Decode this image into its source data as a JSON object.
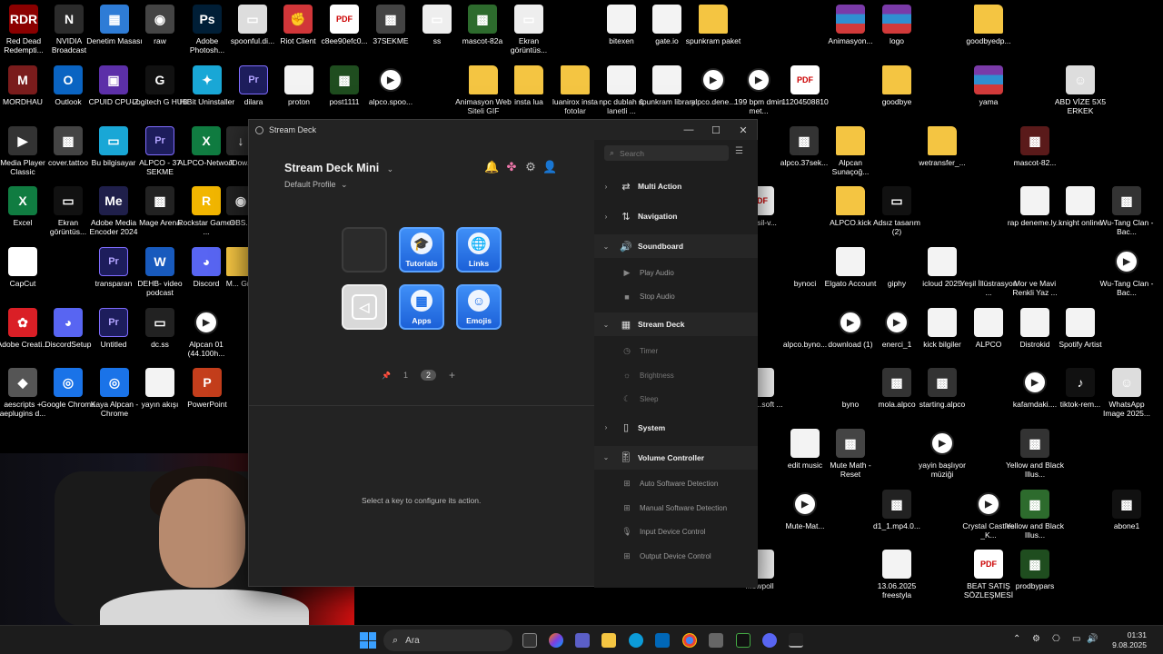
{
  "desktop": {
    "icons": [
      {
        "id": "d1",
        "label": "Red Dead Redempti...",
        "glyph": "RDR",
        "color": "#8b0000"
      },
      {
        "id": "d2",
        "label": "NVIDIA Broadcast",
        "glyph": "N",
        "color": "#2b2b2b"
      },
      {
        "id": "d3",
        "label": "Denetim Masası",
        "glyph": "▦",
        "color": "#2e7cd6"
      },
      {
        "id": "d4",
        "label": "raw",
        "glyph": "◉",
        "color": "#444"
      },
      {
        "id": "d5",
        "label": "Adobe Photosh...",
        "glyph": "Ps",
        "color": "#001e36"
      },
      {
        "id": "d6",
        "label": "spoonful.di...",
        "glyph": "▭",
        "color": "#ddd"
      },
      {
        "id": "d7",
        "label": "Riot Client",
        "glyph": "✊",
        "color": "#d13639"
      },
      {
        "id": "d8",
        "label": "c8ee90efc0...",
        "glyph": "PDF",
        "kind": "pdf"
      },
      {
        "id": "d9",
        "label": "37SEKME",
        "glyph": "▩",
        "color": "#444"
      },
      {
        "id": "d10",
        "label": "ss",
        "glyph": "▭",
        "color": "#eee"
      },
      {
        "id": "d11",
        "label": "mascot-82a",
        "glyph": "▩",
        "color": "#2d6b2d"
      },
      {
        "id": "d12",
        "label": "Ekran görüntüs...",
        "glyph": "▭",
        "color": "#eee"
      },
      {
        "id": "d13",
        "label": "bitexen",
        "glyph": "",
        "kind": "file"
      },
      {
        "id": "d14",
        "label": "gate.io",
        "glyph": "",
        "kind": "file"
      },
      {
        "id": "d15",
        "label": "spunkram paket",
        "glyph": "",
        "kind": "folder"
      },
      {
        "id": "d16",
        "label": "Animasyon...",
        "glyph": "",
        "kind": "rar"
      },
      {
        "id": "d17",
        "label": "logo",
        "glyph": "",
        "kind": "rar"
      },
      {
        "id": "d18",
        "label": "goodbyedp...",
        "glyph": "",
        "kind": "folder"
      },
      {
        "id": "d19",
        "label": "MORDHAU",
        "glyph": "M",
        "color": "#7a1c1c"
      },
      {
        "id": "d20",
        "label": "Outlook",
        "glyph": "O",
        "color": "#0a64c2"
      },
      {
        "id": "d21",
        "label": "CPUID CPU-Z",
        "glyph": "▣",
        "color": "#5c2fa8"
      },
      {
        "id": "d22",
        "label": "Logitech G HUB",
        "glyph": "G",
        "color": "#111"
      },
      {
        "id": "d23",
        "label": "HiBit Uninstaller",
        "glyph": "✦",
        "color": "#19a7d6"
      },
      {
        "id": "d24",
        "label": "dilara",
        "glyph": "Pr",
        "kind": "pr"
      },
      {
        "id": "d25",
        "label": "proton",
        "glyph": "",
        "kind": "file"
      },
      {
        "id": "d26",
        "label": "post1111",
        "glyph": "▩",
        "color": "#1f4d1f"
      },
      {
        "id": "d27",
        "label": "alpco.spoo...",
        "glyph": "▶",
        "kind": "video"
      },
      {
        "id": "d28",
        "label": "Animasyon Web Siteli GIF",
        "glyph": "",
        "kind": "folder"
      },
      {
        "id": "d29",
        "label": "insta lua",
        "glyph": "",
        "kind": "folder"
      },
      {
        "id": "d30",
        "label": "luanirox insta fotolar",
        "glyph": "",
        "kind": "folder"
      },
      {
        "id": "d31",
        "label": "npc dublah & lanetli ...",
        "glyph": "",
        "kind": "file"
      },
      {
        "id": "d32",
        "label": "spunkram library",
        "glyph": "",
        "kind": "file"
      },
      {
        "id": "d33",
        "label": "alpco.dene...",
        "glyph": "▶",
        "kind": "video"
      },
      {
        "id": "d34",
        "label": "199 bpm dmin met...",
        "glyph": "▶",
        "kind": "video"
      },
      {
        "id": "d35",
        "label": "11204508810",
        "glyph": "PDF",
        "kind": "pdf"
      },
      {
        "id": "d36",
        "label": "goodbye",
        "glyph": "",
        "kind": "folder"
      },
      {
        "id": "d37",
        "label": "yama",
        "glyph": "",
        "kind": "rar"
      },
      {
        "id": "d38",
        "label": "ABD VİZE 5X5 ERKEK",
        "glyph": "☺",
        "color": "#ddd"
      },
      {
        "id": "d39",
        "label": "Media Player Classic",
        "glyph": "▶",
        "color": "#333"
      },
      {
        "id": "d40",
        "label": "cover.tattoo",
        "glyph": "▩",
        "color": "#444"
      },
      {
        "id": "d41",
        "label": "Bu bilgisayar",
        "glyph": "▭",
        "color": "#19a7d6"
      },
      {
        "id": "d42",
        "label": "ALPCO - 37 SEKME",
        "glyph": "Pr",
        "kind": "pr"
      },
      {
        "id": "d43",
        "label": "ALPCO-Network",
        "glyph": "X",
        "color": "#107c41"
      },
      {
        "id": "d44",
        "label": "JDow...",
        "glyph": "↓",
        "color": "#2b2b2b"
      },
      {
        "id": "d45",
        "label": "alpco.37sek...",
        "glyph": "▩",
        "color": "#333"
      },
      {
        "id": "d46",
        "label": "Alpcan Sunaçoğ...",
        "glyph": "",
        "kind": "folder"
      },
      {
        "id": "d47",
        "label": "wetransfer_...",
        "glyph": "",
        "kind": "folder"
      },
      {
        "id": "d48",
        "label": "mascot-82...",
        "glyph": "▩",
        "color": "#5a1a1a"
      },
      {
        "id": "d49",
        "label": "Excel",
        "glyph": "X",
        "color": "#107c41"
      },
      {
        "id": "d50",
        "label": "Ekran görüntüs...",
        "glyph": "▭",
        "color": "#111"
      },
      {
        "id": "d51",
        "label": "Adobe Media Encoder 2024",
        "glyph": "Me",
        "color": "#1f1f4a"
      },
      {
        "id": "d52",
        "label": "Mage Arena",
        "glyph": "▩",
        "color": "#222"
      },
      {
        "id": "d53",
        "label": "Rockstar Games ...",
        "glyph": "R",
        "color": "#f2b600"
      },
      {
        "id": "d54",
        "label": "OBS...",
        "glyph": "◉",
        "color": "#222"
      },
      {
        "id": "d55",
        "label": "...ecsil-v...",
        "glyph": "PDF",
        "kind": "pdf"
      },
      {
        "id": "d56",
        "label": "ALPCO.kick",
        "glyph": "",
        "kind": "folder"
      },
      {
        "id": "d57",
        "label": "Adsız tasarım (2)",
        "glyph": "▭",
        "color": "#111"
      },
      {
        "id": "d58",
        "label": "rap deneme.ly...",
        "glyph": "",
        "kind": "file"
      },
      {
        "id": "d59",
        "label": "knight online",
        "glyph": "",
        "kind": "file"
      },
      {
        "id": "d60",
        "label": "Wu-Tang Clan - Bac...",
        "glyph": "▩",
        "color": "#333"
      },
      {
        "id": "d61",
        "label": "CapCut",
        "glyph": "✂",
        "color": "#fff"
      },
      {
        "id": "d62",
        "label": "transparan",
        "glyph": "Pr",
        "kind": "pr"
      },
      {
        "id": "d63",
        "label": "DEHB- video podcast",
        "glyph": "W",
        "color": "#185abd"
      },
      {
        "id": "d64",
        "label": "Discord",
        "glyph": "◕",
        "color": "#5865f2"
      },
      {
        "id": "d65",
        "label": "M... Gr...",
        "glyph": "",
        "kind": "folder"
      },
      {
        "id": "d66",
        "label": "bynoci",
        "glyph": "",
        "color": "#000"
      },
      {
        "id": "d67",
        "label": "Elgato Account",
        "glyph": "",
        "kind": "file"
      },
      {
        "id": "d68",
        "label": "giphy",
        "glyph": "",
        "color": "#000"
      },
      {
        "id": "d69",
        "label": "icloud 2025",
        "glyph": "",
        "kind": "file"
      },
      {
        "id": "d70",
        "label": "Yeşil İllüstrasyon ...",
        "glyph": "",
        "color": "#000"
      },
      {
        "id": "d71",
        "label": "Mor ve Mavi Renkli Yaz ...",
        "glyph": "",
        "color": "#000"
      },
      {
        "id": "d72",
        "label": "Wu-Tang Clan - Bac...",
        "glyph": "▶",
        "kind": "video"
      },
      {
        "id": "d73",
        "label": "Adobe Creati...",
        "glyph": "✿",
        "color": "#da1f26"
      },
      {
        "id": "d74",
        "label": "DiscordSetup",
        "glyph": "◕",
        "color": "#5865f2"
      },
      {
        "id": "d75",
        "label": "Untitled",
        "glyph": "Pr",
        "kind": "pr"
      },
      {
        "id": "d76",
        "label": "dc.ss",
        "glyph": "▭",
        "color": "#222"
      },
      {
        "id": "d77",
        "label": "Alpcan 01 (44.100h...",
        "glyph": "▶",
        "kind": "video"
      },
      {
        "id": "d78",
        "label": "alpco.byno...",
        "glyph": "",
        "color": "#000"
      },
      {
        "id": "d79",
        "label": "download (1)",
        "glyph": "▶",
        "kind": "video"
      },
      {
        "id": "d80",
        "label": "enerci_1",
        "glyph": "▶",
        "kind": "video"
      },
      {
        "id": "d81",
        "label": "kick bilgiler",
        "glyph": "",
        "kind": "file"
      },
      {
        "id": "d82",
        "label": "ALPCO",
        "glyph": "",
        "kind": "file"
      },
      {
        "id": "d83",
        "label": "Distrokid",
        "glyph": "",
        "kind": "file"
      },
      {
        "id": "d84",
        "label": "Spotify Artist",
        "glyph": "",
        "kind": "file"
      },
      {
        "id": "d85",
        "label": "aescripts + aeplugins d...",
        "glyph": "◆",
        "color": "#555"
      },
      {
        "id": "d86",
        "label": "Google Chrome",
        "glyph": "◎",
        "color": "#1a73e8"
      },
      {
        "id": "d87",
        "label": "Kaya Alpcan - Chrome",
        "glyph": "◎",
        "color": "#1a73e8"
      },
      {
        "id": "d88",
        "label": "yayın akışı",
        "glyph": "",
        "kind": "file"
      },
      {
        "id": "d89",
        "label": "PowerPoint",
        "glyph": "P",
        "color": "#c43e1c"
      },
      {
        "id": "d90",
        "label": "...eni ...soft ...",
        "glyph": "",
        "kind": "file"
      },
      {
        "id": "d91",
        "label": "byno",
        "glyph": "",
        "color": "#000"
      },
      {
        "id": "d92",
        "label": "mola.alpco",
        "glyph": "▩",
        "color": "#333"
      },
      {
        "id": "d93",
        "label": "starting.alpco",
        "glyph": "▩",
        "color": "#333"
      },
      {
        "id": "d94",
        "label": "kafamdaki....",
        "glyph": "▶",
        "kind": "video"
      },
      {
        "id": "d95",
        "label": "tiktok-rem...",
        "glyph": "♪",
        "color": "#111"
      },
      {
        "id": "d96",
        "label": "WhatsApp Image 2025...",
        "glyph": "☺",
        "color": "#ddd"
      },
      {
        "id": "d97",
        "label": "edit music",
        "glyph": "",
        "kind": "file"
      },
      {
        "id": "d98",
        "label": "Mute Math - Reset",
        "glyph": "▩",
        "color": "#444"
      },
      {
        "id": "d99",
        "label": "yayin başlıyor müziği",
        "glyph": "▶",
        "kind": "video"
      },
      {
        "id": "d100",
        "label": "Yellow and Black Illus...",
        "glyph": "▩",
        "color": "#333"
      },
      {
        "id": "d101",
        "label": "Mute-Mat...",
        "glyph": "▶",
        "kind": "video"
      },
      {
        "id": "d102",
        "label": "d1_1.mp4.0...",
        "glyph": "▩",
        "color": "#222"
      },
      {
        "id": "d103",
        "label": "Crystal Castles _K...",
        "glyph": "▶",
        "kind": "video"
      },
      {
        "id": "d104",
        "label": "Yellow and Black Illus...",
        "glyph": "▩",
        "color": "#2d6b2d"
      },
      {
        "id": "d105",
        "label": "abone1",
        "glyph": "▩",
        "color": "#111"
      },
      {
        "id": "d106",
        "label": "...ewpoll",
        "glyph": "",
        "kind": "file"
      },
      {
        "id": "d107",
        "label": "13.06.2025 freestyla",
        "glyph": "",
        "kind": "file"
      },
      {
        "id": "d108",
        "label": "BEAT SATIŞ SÖZLEŞMESİ",
        "glyph": "PDF",
        "kind": "pdf"
      },
      {
        "id": "d109",
        "label": "prodbypars",
        "glyph": "▩",
        "color": "#1f4d1f"
      }
    ]
  },
  "window": {
    "title": "Stream Deck",
    "minimize_icon": "—",
    "maximize_icon": "☐",
    "close_icon": "✕"
  },
  "device": {
    "name": "Stream Deck Mini",
    "profile": "Default Profile",
    "header_icons": {
      "bell": "🔔",
      "marketplace": "✤",
      "settings": "⚙",
      "account": "👤"
    }
  },
  "keys": [
    {
      "label": "",
      "icon": "",
      "style": "empty"
    },
    {
      "label": "Tutorials",
      "icon": "🎓",
      "style": "blue"
    },
    {
      "label": "Links",
      "icon": "🌐",
      "style": "blue"
    },
    {
      "label": "",
      "icon": "◁",
      "style": "back"
    },
    {
      "label": "Apps",
      "icon": "▦",
      "style": "blue"
    },
    {
      "label": "Emojis",
      "icon": "☺",
      "style": "blue"
    }
  ],
  "pager": {
    "pin_icon": "📌",
    "pages": [
      "1",
      "2"
    ],
    "current": "2",
    "add": "+"
  },
  "hint": "Select a key to configure its action.",
  "actions_panel": {
    "search_placeholder": "Search",
    "list_icon": "☰",
    "categories": [
      {
        "label": "Multi Action",
        "icon": "⇄",
        "chevron": "›",
        "open": false
      },
      {
        "label": "Navigation",
        "icon": "⇅",
        "chevron": "›",
        "open": false
      },
      {
        "label": "Soundboard",
        "icon": "🔊",
        "chevron": "⌄",
        "open": true,
        "items": [
          {
            "label": "Play Audio",
            "icon": "▶"
          },
          {
            "label": "Stop Audio",
            "icon": "■"
          }
        ]
      },
      {
        "label": "Stream Deck",
        "icon": "▦",
        "chevron": "⌄",
        "open": true,
        "items": [
          {
            "label": "Timer",
            "icon": "◷"
          },
          {
            "label": "Brightness",
            "icon": "☼"
          },
          {
            "label": "Sleep",
            "icon": "☾"
          }
        ]
      },
      {
        "label": "System",
        "icon": "▯",
        "chevron": "›",
        "open": false
      },
      {
        "label": "Volume Controller",
        "icon": "🎚",
        "chevron": "⌄",
        "open": true,
        "items": [
          {
            "label": "Auto Software Detection",
            "icon": "⊞"
          },
          {
            "label": "Manual Software Detection",
            "icon": "⊞"
          },
          {
            "label": "Input Device Control",
            "icon": "🎙"
          },
          {
            "label": "Output Device Control",
            "icon": "⊞"
          }
        ]
      }
    ]
  },
  "taskbar": {
    "search_text": "Ara",
    "search_icon": "⌕",
    "time": "01:31",
    "date": "9.08.2025",
    "accent": "#3aa0ff"
  }
}
